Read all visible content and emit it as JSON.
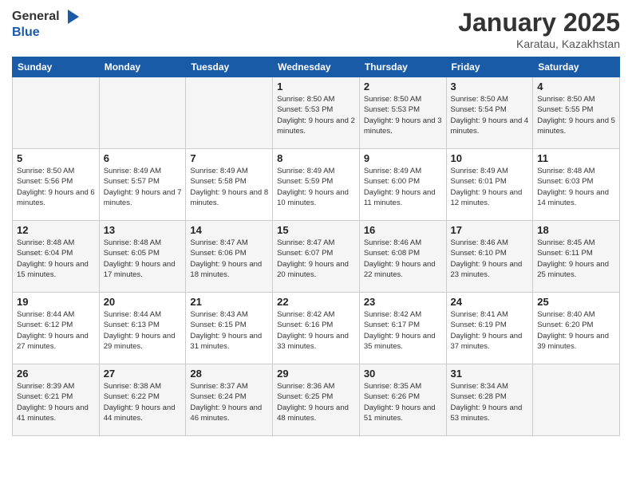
{
  "logo": {
    "general": "General",
    "blue": "Blue"
  },
  "title": {
    "month": "January 2025",
    "location": "Karatau, Kazakhstan"
  },
  "weekdays": [
    "Sunday",
    "Monday",
    "Tuesday",
    "Wednesday",
    "Thursday",
    "Friday",
    "Saturday"
  ],
  "weeks": [
    [
      {
        "day": "",
        "sunrise": "",
        "sunset": "",
        "daylight": ""
      },
      {
        "day": "",
        "sunrise": "",
        "sunset": "",
        "daylight": ""
      },
      {
        "day": "",
        "sunrise": "",
        "sunset": "",
        "daylight": ""
      },
      {
        "day": "1",
        "sunrise": "Sunrise: 8:50 AM",
        "sunset": "Sunset: 5:53 PM",
        "daylight": "Daylight: 9 hours and 2 minutes."
      },
      {
        "day": "2",
        "sunrise": "Sunrise: 8:50 AM",
        "sunset": "Sunset: 5:53 PM",
        "daylight": "Daylight: 9 hours and 3 minutes."
      },
      {
        "day": "3",
        "sunrise": "Sunrise: 8:50 AM",
        "sunset": "Sunset: 5:54 PM",
        "daylight": "Daylight: 9 hours and 4 minutes."
      },
      {
        "day": "4",
        "sunrise": "Sunrise: 8:50 AM",
        "sunset": "Sunset: 5:55 PM",
        "daylight": "Daylight: 9 hours and 5 minutes."
      }
    ],
    [
      {
        "day": "5",
        "sunrise": "Sunrise: 8:50 AM",
        "sunset": "Sunset: 5:56 PM",
        "daylight": "Daylight: 9 hours and 6 minutes."
      },
      {
        "day": "6",
        "sunrise": "Sunrise: 8:49 AM",
        "sunset": "Sunset: 5:57 PM",
        "daylight": "Daylight: 9 hours and 7 minutes."
      },
      {
        "day": "7",
        "sunrise": "Sunrise: 8:49 AM",
        "sunset": "Sunset: 5:58 PM",
        "daylight": "Daylight: 9 hours and 8 minutes."
      },
      {
        "day": "8",
        "sunrise": "Sunrise: 8:49 AM",
        "sunset": "Sunset: 5:59 PM",
        "daylight": "Daylight: 9 hours and 10 minutes."
      },
      {
        "day": "9",
        "sunrise": "Sunrise: 8:49 AM",
        "sunset": "Sunset: 6:00 PM",
        "daylight": "Daylight: 9 hours and 11 minutes."
      },
      {
        "day": "10",
        "sunrise": "Sunrise: 8:49 AM",
        "sunset": "Sunset: 6:01 PM",
        "daylight": "Daylight: 9 hours and 12 minutes."
      },
      {
        "day": "11",
        "sunrise": "Sunrise: 8:48 AM",
        "sunset": "Sunset: 6:03 PM",
        "daylight": "Daylight: 9 hours and 14 minutes."
      }
    ],
    [
      {
        "day": "12",
        "sunrise": "Sunrise: 8:48 AM",
        "sunset": "Sunset: 6:04 PM",
        "daylight": "Daylight: 9 hours and 15 minutes."
      },
      {
        "day": "13",
        "sunrise": "Sunrise: 8:48 AM",
        "sunset": "Sunset: 6:05 PM",
        "daylight": "Daylight: 9 hours and 17 minutes."
      },
      {
        "day": "14",
        "sunrise": "Sunrise: 8:47 AM",
        "sunset": "Sunset: 6:06 PM",
        "daylight": "Daylight: 9 hours and 18 minutes."
      },
      {
        "day": "15",
        "sunrise": "Sunrise: 8:47 AM",
        "sunset": "Sunset: 6:07 PM",
        "daylight": "Daylight: 9 hours and 20 minutes."
      },
      {
        "day": "16",
        "sunrise": "Sunrise: 8:46 AM",
        "sunset": "Sunset: 6:08 PM",
        "daylight": "Daylight: 9 hours and 22 minutes."
      },
      {
        "day": "17",
        "sunrise": "Sunrise: 8:46 AM",
        "sunset": "Sunset: 6:10 PM",
        "daylight": "Daylight: 9 hours and 23 minutes."
      },
      {
        "day": "18",
        "sunrise": "Sunrise: 8:45 AM",
        "sunset": "Sunset: 6:11 PM",
        "daylight": "Daylight: 9 hours and 25 minutes."
      }
    ],
    [
      {
        "day": "19",
        "sunrise": "Sunrise: 8:44 AM",
        "sunset": "Sunset: 6:12 PM",
        "daylight": "Daylight: 9 hours and 27 minutes."
      },
      {
        "day": "20",
        "sunrise": "Sunrise: 8:44 AM",
        "sunset": "Sunset: 6:13 PM",
        "daylight": "Daylight: 9 hours and 29 minutes."
      },
      {
        "day": "21",
        "sunrise": "Sunrise: 8:43 AM",
        "sunset": "Sunset: 6:15 PM",
        "daylight": "Daylight: 9 hours and 31 minutes."
      },
      {
        "day": "22",
        "sunrise": "Sunrise: 8:42 AM",
        "sunset": "Sunset: 6:16 PM",
        "daylight": "Daylight: 9 hours and 33 minutes."
      },
      {
        "day": "23",
        "sunrise": "Sunrise: 8:42 AM",
        "sunset": "Sunset: 6:17 PM",
        "daylight": "Daylight: 9 hours and 35 minutes."
      },
      {
        "day": "24",
        "sunrise": "Sunrise: 8:41 AM",
        "sunset": "Sunset: 6:19 PM",
        "daylight": "Daylight: 9 hours and 37 minutes."
      },
      {
        "day": "25",
        "sunrise": "Sunrise: 8:40 AM",
        "sunset": "Sunset: 6:20 PM",
        "daylight": "Daylight: 9 hours and 39 minutes."
      }
    ],
    [
      {
        "day": "26",
        "sunrise": "Sunrise: 8:39 AM",
        "sunset": "Sunset: 6:21 PM",
        "daylight": "Daylight: 9 hours and 41 minutes."
      },
      {
        "day": "27",
        "sunrise": "Sunrise: 8:38 AM",
        "sunset": "Sunset: 6:22 PM",
        "daylight": "Daylight: 9 hours and 44 minutes."
      },
      {
        "day": "28",
        "sunrise": "Sunrise: 8:37 AM",
        "sunset": "Sunset: 6:24 PM",
        "daylight": "Daylight: 9 hours and 46 minutes."
      },
      {
        "day": "29",
        "sunrise": "Sunrise: 8:36 AM",
        "sunset": "Sunset: 6:25 PM",
        "daylight": "Daylight: 9 hours and 48 minutes."
      },
      {
        "day": "30",
        "sunrise": "Sunrise: 8:35 AM",
        "sunset": "Sunset: 6:26 PM",
        "daylight": "Daylight: 9 hours and 51 minutes."
      },
      {
        "day": "31",
        "sunrise": "Sunrise: 8:34 AM",
        "sunset": "Sunset: 6:28 PM",
        "daylight": "Daylight: 9 hours and 53 minutes."
      },
      {
        "day": "",
        "sunrise": "",
        "sunset": "",
        "daylight": ""
      }
    ]
  ]
}
